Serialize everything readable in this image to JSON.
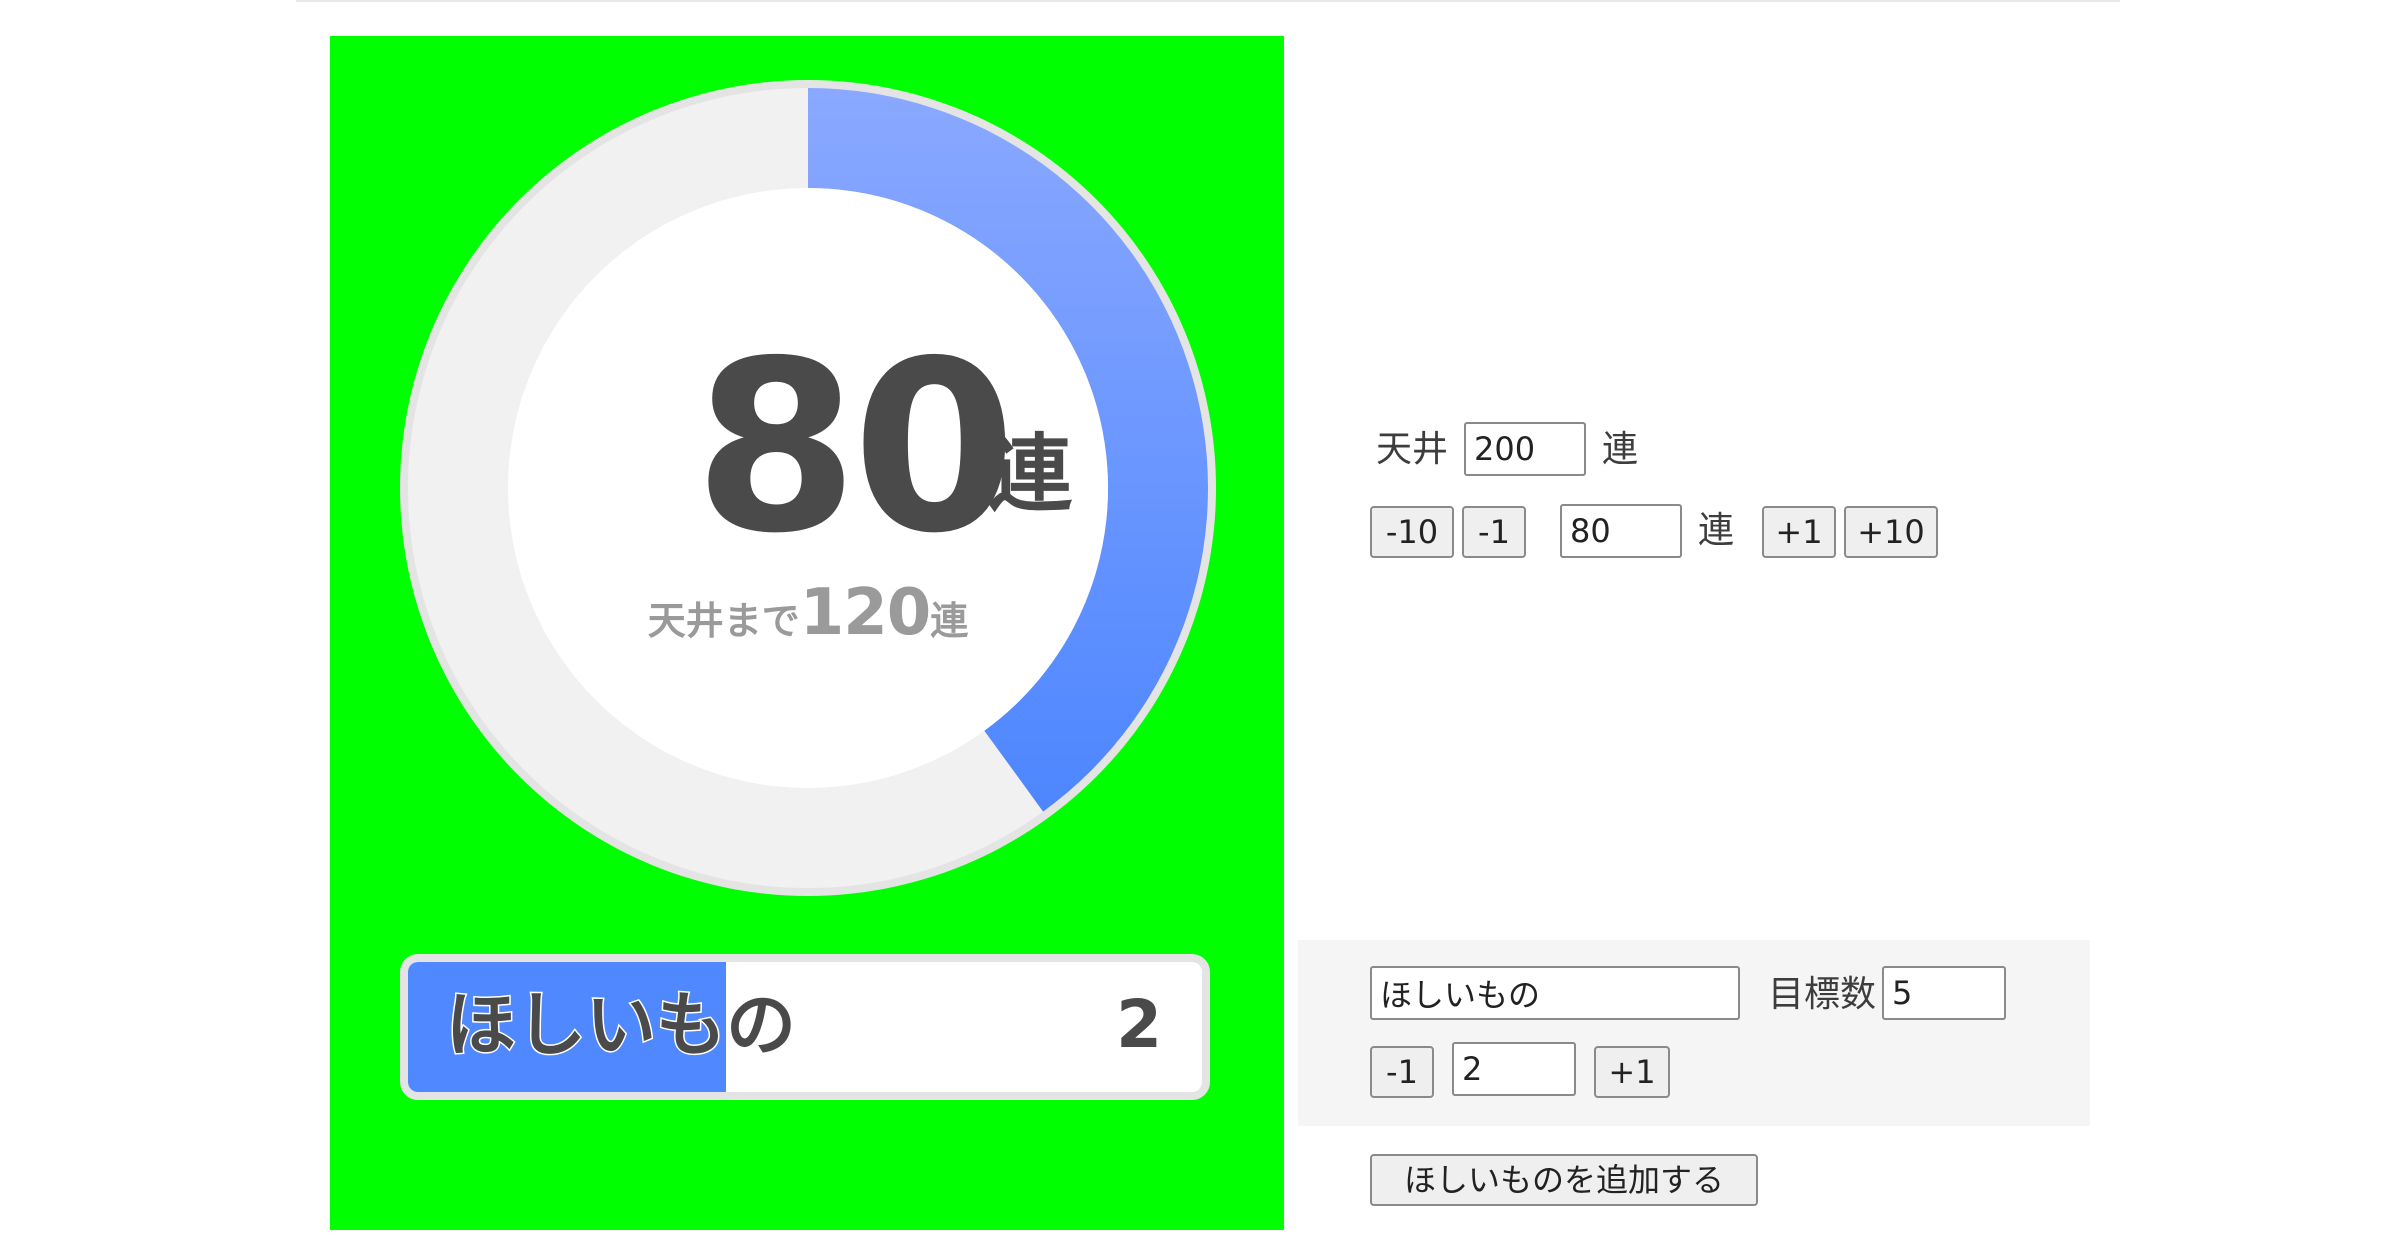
{
  "preview": {
    "stage_color": "#00ff00",
    "gauge": {
      "current": 80,
      "ceiling": 200,
      "progress_fraction": 0.4,
      "unit": "連",
      "remaining_prefix": "天井まで",
      "remaining": 120,
      "remaining_unit": "連",
      "track_color": "#f1f1f1",
      "ring_border_color": "#e4e4e4",
      "fill_color_start": "#8aa8ff",
      "fill_color_end": "#4d86ff"
    },
    "wish_bar": {
      "name": "ほしいもの",
      "count": "2",
      "progress_fraction": 0.4,
      "fill_color": "#4f88ff"
    }
  },
  "controls": {
    "ceiling_label": "天井",
    "ceiling_value": "200",
    "ceiling_unit": "連",
    "minus10": "-10",
    "minus1": "-1",
    "count_value": "80",
    "count_unit": "連",
    "plus1": "+1",
    "plus10": "+10"
  },
  "wish_editor": {
    "name_value": "ほしいもの",
    "target_label": "目標数",
    "target_value": "5",
    "minus1": "-1",
    "count_value": "2",
    "plus1": "+1",
    "add_button": "ほしいものを追加する"
  }
}
